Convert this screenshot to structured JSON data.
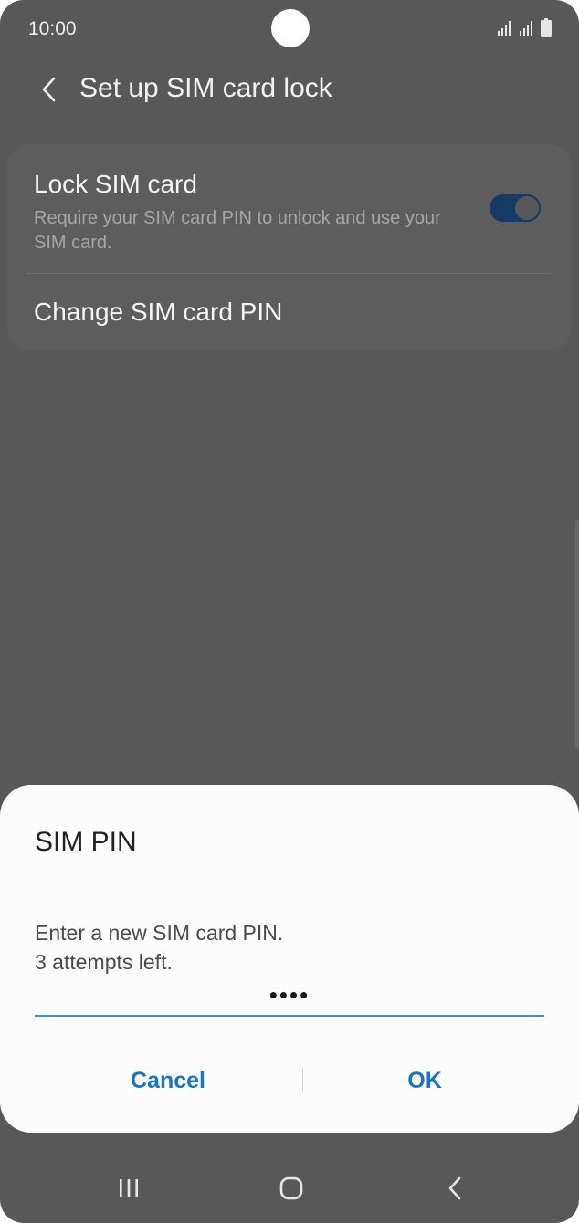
{
  "status_bar": {
    "time": "10:00"
  },
  "header": {
    "title": "Set up SIM card lock"
  },
  "settings": {
    "lock_sim": {
      "title": "Lock SIM card",
      "subtitle": "Require your SIM card PIN to unlock and use your SIM card.",
      "enabled": true
    },
    "change_pin": {
      "title": "Change SIM card PIN"
    }
  },
  "dialog": {
    "title": "SIM PIN",
    "message_line1": "Enter a new SIM card PIN.",
    "message_line2": "3 attempts left.",
    "pin_value": "••••",
    "cancel_label": "Cancel",
    "ok_label": "OK"
  },
  "colors": {
    "accent": "#1a73c5",
    "toggle_on": "#153a66",
    "input_underline": "#3a8fd8"
  },
  "icons": {
    "back": "chevron-left-icon",
    "signal": "signal-bars-icon",
    "battery": "battery-icon",
    "nav_recents": "recents-icon",
    "nav_home": "home-icon",
    "nav_back": "back-icon"
  }
}
